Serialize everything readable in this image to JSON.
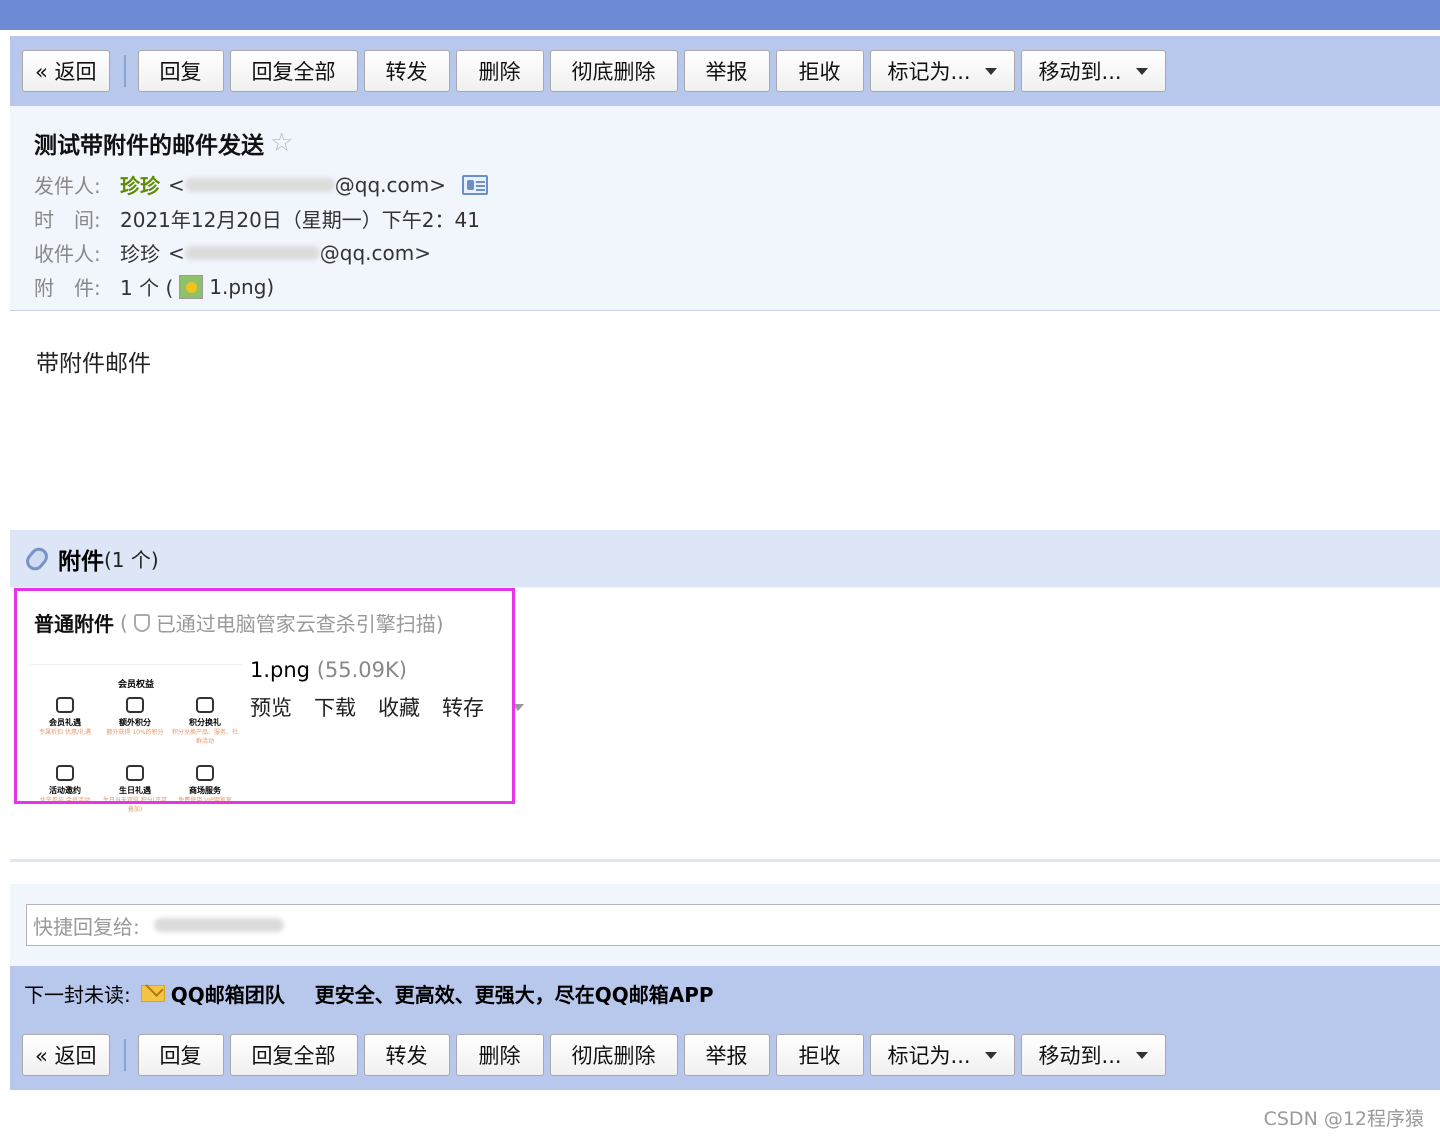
{
  "toolbar": {
    "back": "« 返回",
    "reply": "回复",
    "reply_all": "回复全部",
    "forward": "转发",
    "delete": "删除",
    "delete_permanently": "彻底删除",
    "report": "举报",
    "reject": "拒收",
    "mark_as": "标记为...",
    "move_to": "移动到..."
  },
  "mail": {
    "subject": "测试带附件的邮件发送",
    "sender_label": "发件人:",
    "sender_name": "珍珍",
    "sender_email_visible": "<",
    "sender_email_suffix": "@qq.com>",
    "time_label": "时　间:",
    "time_value": "2021年12月20日（星期一）下午2：41",
    "recipient_label": "收件人:",
    "recipient_name": "珍珍",
    "recipient_email_prefix": "<",
    "recipient_email_suffix": "@qq.com>",
    "attachment_label": "附　件:",
    "attachment_count": "1 个 (",
    "attachment_file": "1.png",
    "attachment_close": ")",
    "body": "带附件邮件"
  },
  "attachments": {
    "title": "附件",
    "count": "(1 个)",
    "normal_title": "普通附件",
    "scan_open": "(",
    "scan_text": "已通过电脑管家云查杀引擎扫描)",
    "file_name": "1.png",
    "file_size": "(55.09K)",
    "actions": {
      "preview": "预览",
      "download": "下载",
      "favorite": "收藏",
      "save_to": "转存"
    },
    "thumbnail": {
      "title": "会员权益",
      "items": [
        {
          "label": "会员礼遇",
          "sub": "专属折扣 优惠/礼遇"
        },
        {
          "label": "额外积分",
          "sub": "额外获得 10%的积分"
        },
        {
          "label": "积分换礼",
          "sub": "积分兑换产品、服务、社群活动"
        },
        {
          "label": "活动邀约",
          "sub": "优先参与 会员活动"
        },
        {
          "label": "生日礼遇",
          "sub": "生日当天双倍 积分(不可叠加)"
        },
        {
          "label": "商场服务",
          "sub": "免费使用 VIP期室室"
        }
      ]
    }
  },
  "quick_reply": {
    "placeholder": "快捷回复给:"
  },
  "next_unread": {
    "label": "下一封未读:",
    "sender": "QQ邮箱团队",
    "subject": "更安全、更高效、更强大，尽在QQ邮箱APP"
  },
  "watermark": "CSDN @12程序猿",
  "colors": {
    "topbar": "#6c8ad3",
    "toolbar": "#b8c8ec",
    "header_bg": "#f1f5fc",
    "sender_name": "#5e8a00",
    "highlight": "#e634e6"
  }
}
